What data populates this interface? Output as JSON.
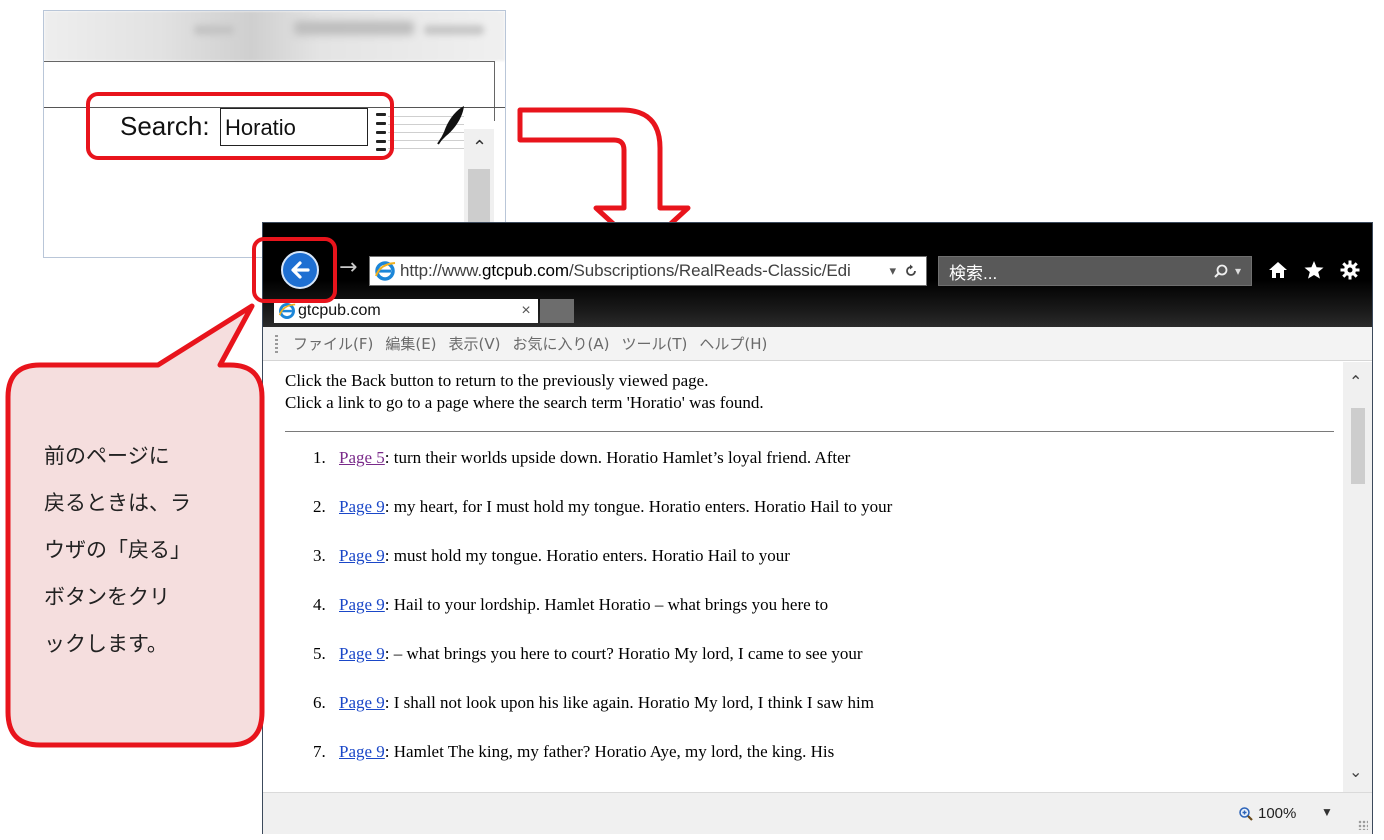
{
  "inset": {
    "search_label": "Search:",
    "search_value": "Horatio",
    "scroll_up_glyph": "^"
  },
  "browser": {
    "address": {
      "scheme": "http://www.",
      "host": "gtcpub.com",
      "path": "/Subscriptions/RealReads-Classic/Edi"
    },
    "search_placeholder": "検索...",
    "tab": {
      "title": "gtcpub.com",
      "close_glyph": "×"
    },
    "menu": [
      "ファイル(F)",
      "編集(E)",
      "表示(V)",
      "お気に入り(A)",
      "ツール(T)",
      "ヘルプ(H)"
    ],
    "instructions": [
      "Click the Back button to return to the previously viewed page.",
      "Click a link to go to a page where the search term 'Horatio' was found."
    ],
    "results": [
      {
        "num": "1.",
        "link": "Page 5",
        "visited": true,
        "text": ": turn their worlds upside down. Horatio Hamlet’s loyal friend. After"
      },
      {
        "num": "2.",
        "link": "Page 9",
        "visited": false,
        "text": ": my heart, for I must hold my tongue. Horatio enters. Horatio Hail to your"
      },
      {
        "num": "3.",
        "link": "Page 9",
        "visited": false,
        "text": ": must hold my tongue. Horatio enters. Horatio Hail to your"
      },
      {
        "num": "4.",
        "link": "Page 9",
        "visited": false,
        "text": ": Hail to your lordship. Hamlet Horatio – what brings you here to"
      },
      {
        "num": "5.",
        "link": "Page 9",
        "visited": false,
        "text": ": – what brings you here to court? Horatio My lord, I came to see your"
      },
      {
        "num": "6.",
        "link": "Page 9",
        "visited": false,
        "text": ": I shall not look upon his like again. Horatio My lord, I think I saw him"
      },
      {
        "num": "7.",
        "link": "Page 9",
        "visited": false,
        "text": ": Hamlet The king, my father? Horatio Aye, my lord, the king. His"
      }
    ],
    "zoom": "100%"
  },
  "callout": {
    "lines": [
      "前のページに",
      "戻るときは、ラ",
      "ウザの「戻る」",
      "ボタンをクリ",
      "ックします。"
    ]
  },
  "colors": {
    "highlight": "#e8141c",
    "callout_fill": "#f5dede",
    "link": "#1a47c8",
    "visited_link": "#7a2a8a",
    "back_button": "#1e6fd2"
  },
  "icons": {
    "back": "back-arrow-icon",
    "forward": "forward-arrow-icon",
    "ie": "ie-logo-icon",
    "refresh": "refresh-icon",
    "search": "search-icon",
    "home": "home-icon",
    "favorites": "star-icon",
    "settings": "gear-icon",
    "zoom": "zoom-icon"
  }
}
